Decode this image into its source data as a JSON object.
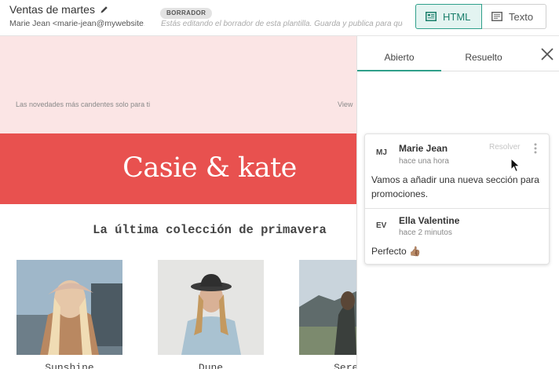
{
  "header": {
    "template_name": "Ventas de martes",
    "sender": "Marie Jean <marie-jean@mywebsite.com>",
    "status_badge": "BORRADOR",
    "notice": "Estás editando el borrador de esta plantilla. Guarda y publica para que los cambios se apliquen.",
    "view_toggle": {
      "html_label": "HTML",
      "text_label": "Texto",
      "selected": "HTML"
    }
  },
  "email": {
    "preheader_text": "Las novedades más candentes solo para ti",
    "view_online_label": "View",
    "logo_text": "Casie & kate",
    "collection_title": "La última colección de primavera",
    "products": [
      {
        "title": "Sunshine"
      },
      {
        "title": "Dune"
      },
      {
        "title": "Serene"
      }
    ],
    "colors": {
      "preheader_bg": "#fbe5e5",
      "banner_bg": "#e8514f",
      "accent": "#2f9f8a"
    }
  },
  "comments_panel": {
    "tabs": [
      {
        "label": "Abierto",
        "active": true
      },
      {
        "label": "Resuelto",
        "active": false
      }
    ],
    "close_icon": "close-icon",
    "thread": {
      "resolve_label": "Resolver",
      "comments": [
        {
          "initials": "MJ",
          "author": "Marie Jean",
          "time": "hace una hora",
          "text": "Vamos a añadir una nueva sección para promociones."
        },
        {
          "initials": "EV",
          "author": "Ella Valentine",
          "time": "hace 2 minutos",
          "text": "Perfecto 👍🏽"
        }
      ]
    }
  }
}
